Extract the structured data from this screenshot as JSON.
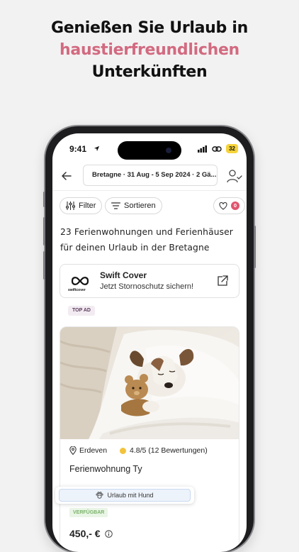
{
  "headline": {
    "line1": "Genießen Sie Urlaub in",
    "line2": "haustierfreundlichen",
    "line3": "Unterkünften"
  },
  "status_bar": {
    "time": "9:41",
    "battery": "32"
  },
  "search": {
    "summary": "Bretagne · 31 Aug - 5 Sep 2024 · 2 Gä..."
  },
  "toolbar": {
    "filter_label": "Filter",
    "sort_label": "Sortieren",
    "favorites_count": "0"
  },
  "results": {
    "title": "23 Ferienwohnungen und Ferienhäuser für deinen Urlaub in der Bretagne"
  },
  "promo": {
    "logo_text": "swiftcover",
    "title": "Swift Cover",
    "subtitle": "Jetzt Stornoschutz sichern!"
  },
  "ad_badge": "TOP AD",
  "listing": {
    "location": "Erdeven",
    "rating": "4.8/5 (12 Bewertungen)",
    "name": "Ferienwohnung Ty",
    "dog_label": "Urlaub mit Hund",
    "availability": "VERFÜGBAR",
    "price": "450,- €"
  },
  "colors": {
    "accent": "#d26a80",
    "favorite_badge": "#e0556f",
    "available_text": "#7bb36a",
    "rating_dot": "#f2c33b"
  },
  "icons": [
    "back-arrow-icon",
    "user-check-icon",
    "sliders-icon",
    "sort-icon",
    "heart-icon",
    "swiftcover-logo-icon",
    "external-link-icon",
    "map-pin-icon",
    "paw-icon",
    "info-icon"
  ]
}
